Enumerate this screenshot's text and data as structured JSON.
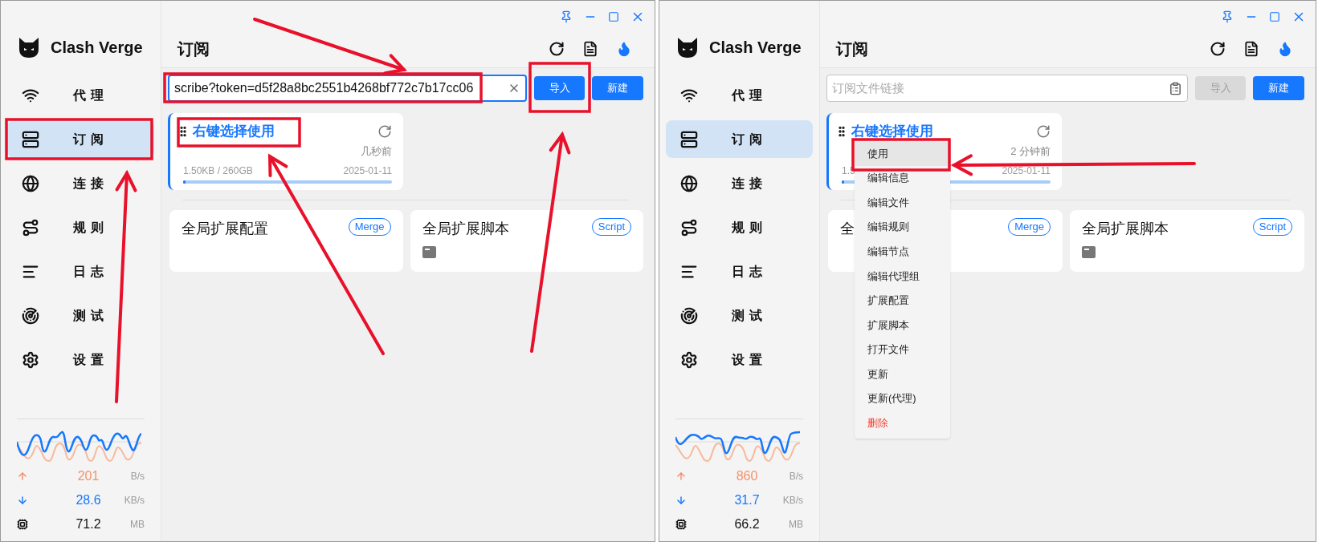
{
  "windows": [
    {
      "logo": "Clash Verge",
      "page_title": "订阅",
      "nav": [
        {
          "label": "代理",
          "selected": false
        },
        {
          "label": "订阅",
          "selected": true
        },
        {
          "label": "连接",
          "selected": false
        },
        {
          "label": "规则",
          "selected": false
        },
        {
          "label": "日志",
          "selected": false
        },
        {
          "label": "测试",
          "selected": false
        },
        {
          "label": "设置",
          "selected": false
        }
      ],
      "traffic": {
        "upload": {
          "value": "201",
          "unit": "B/s"
        },
        "download": {
          "value": "28.6",
          "unit": "KB/s"
        },
        "memory": {
          "value": "71.2",
          "unit": "MB"
        }
      },
      "url_field": {
        "value": "scribe?token=d5f28a8bc2551b4268bf772c7b17cc06"
      },
      "import_button": {
        "label": "导入",
        "disabled": false
      },
      "new_button": "新建",
      "profile": {
        "title": "右键选择使用",
        "updated": "几秒前",
        "usage": "1.50KB / 260GB",
        "date": "2025-01-11",
        "level": 0.01,
        "selected": true
      },
      "enhance_cards": [
        {
          "title": "全局扩展配置",
          "badge": "Merge",
          "kind": "merge"
        },
        {
          "title": "全局扩展脚本",
          "badge": "Script",
          "kind": "script"
        }
      ]
    },
    {
      "logo": "Clash Verge",
      "page_title": "订阅",
      "nav": [
        {
          "label": "代理",
          "selected": false
        },
        {
          "label": "订阅",
          "selected": true
        },
        {
          "label": "连接",
          "selected": false
        },
        {
          "label": "规则",
          "selected": false
        },
        {
          "label": "日志",
          "selected": false
        },
        {
          "label": "测试",
          "selected": false
        },
        {
          "label": "设置",
          "selected": false
        }
      ],
      "traffic": {
        "upload": {
          "value": "860",
          "unit": "B/s"
        },
        "download": {
          "value": "31.7",
          "unit": "KB/s"
        },
        "memory": {
          "value": "66.2",
          "unit": "MB"
        }
      },
      "url_field": {
        "placeholder": "订阅文件链接"
      },
      "import_button": {
        "label": "导入",
        "disabled": true
      },
      "new_button": "新建",
      "profile": {
        "title": "右键选择使用",
        "updated": "2 分钟前",
        "usage": "1.5",
        "date": "2025-01-11",
        "level": 0.01,
        "selected": true
      },
      "enhance_cards": [
        {
          "title": "全",
          "badge": "Merge",
          "kind": "merge"
        },
        {
          "title": "全局扩展脚本",
          "badge": "Script",
          "kind": "script"
        }
      ],
      "context_menu": [
        {
          "label": "使用",
          "kind": "normal",
          "selected": true
        },
        {
          "label": "编辑信息",
          "kind": "normal",
          "selected": false
        },
        {
          "label": "编辑文件",
          "kind": "normal",
          "selected": false
        },
        {
          "label": "编辑规则",
          "kind": "normal",
          "selected": false
        },
        {
          "label": "编辑节点",
          "kind": "normal",
          "selected": false
        },
        {
          "label": "编辑代理组",
          "kind": "normal",
          "selected": false
        },
        {
          "label": "扩展配置",
          "kind": "normal",
          "selected": false
        },
        {
          "label": "扩展脚本",
          "kind": "normal",
          "selected": false
        },
        {
          "label": "打开文件",
          "kind": "normal",
          "selected": false
        },
        {
          "label": "更新",
          "kind": "normal",
          "selected": false
        },
        {
          "label": "更新(代理)",
          "kind": "normal",
          "selected": false
        },
        {
          "label": "删除",
          "kind": "danger",
          "selected": false
        }
      ]
    }
  ]
}
